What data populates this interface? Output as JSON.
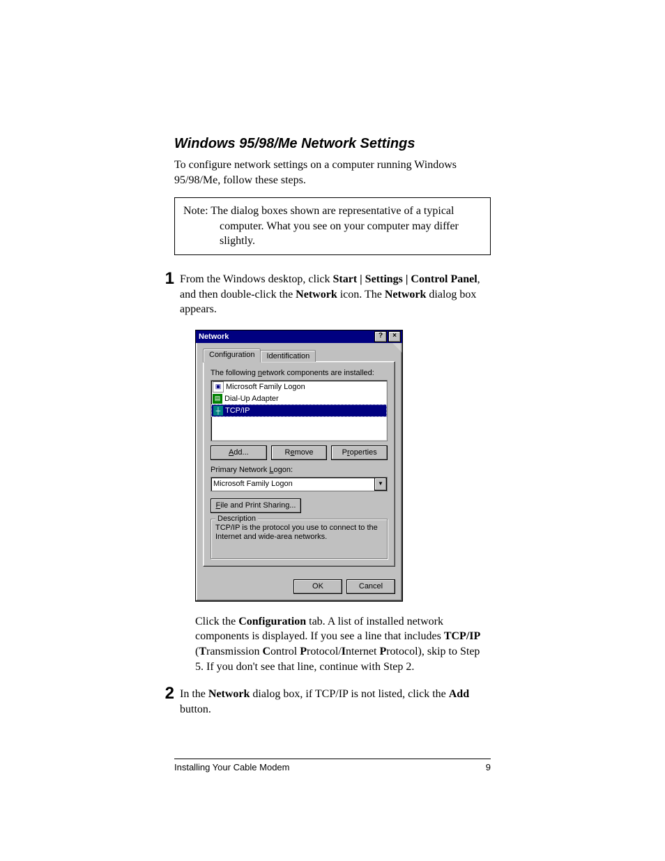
{
  "heading": "Windows 95/98/Me Network Settings",
  "intro": "To configure network settings on a computer running Windows 95/98/Me, follow these steps.",
  "note": {
    "label": "Note:",
    "line1": "The dialog boxes shown are representative of a typical",
    "line2": "computer. What you see on your computer may differ",
    "line3": "slightly."
  },
  "step1": {
    "num": "1",
    "pre": "From the Windows desktop, click ",
    "b1": "Start | Settings | Control Panel",
    "mid": ", and then double-click the ",
    "b2": "Network",
    "post1": " icon. The ",
    "b3": "Network",
    "post2": " dialog box appears."
  },
  "dialog": {
    "title": "Network",
    "help_btn": "?",
    "close_btn": "×",
    "tabs": {
      "configuration": "Configuration",
      "identification": "Identification"
    },
    "installed_label_pre": "The following ",
    "installed_label_u": "n",
    "installed_label_post": "etwork components are installed:",
    "items": {
      "0": "Microsoft Family Logon",
      "1": "Dial-Up Adapter",
      "2": "TCP/IP"
    },
    "buttons": {
      "add_u": "A",
      "add_post": "dd...",
      "remove_pre": "R",
      "remove_u": "e",
      "remove_post": "move",
      "properties_pre": "P",
      "properties_u": "r",
      "properties_post": "operties"
    },
    "primary_label_pre": "Primary Network ",
    "primary_label_u": "L",
    "primary_label_post": "ogon:",
    "primary_value": "Microsoft Family Logon",
    "fps_u": "F",
    "fps_post": "ile and Print Sharing...",
    "desc_legend": "Description",
    "desc_text": "TCP/IP is the protocol you use to connect to the Internet and wide-area networks.",
    "ok": "OK",
    "cancel": "Cancel"
  },
  "after1": {
    "pre": "Click the ",
    "b1": "Configuration",
    "mid1": " tab. A list of installed network components is displayed. If you see a line that includes ",
    "b2": "TCP/IP",
    "mid2": " (",
    "b3": "T",
    "mid3": "ransmission ",
    "b4": "C",
    "mid4": "ontrol ",
    "b5": "P",
    "mid5": "rotocol/",
    "b6": "I",
    "mid6": "nternet ",
    "b7": "P",
    "mid7": "rotocol), skip to Step 5. If you don't see that line, continue with Step 2."
  },
  "step2": {
    "num": "2",
    "pre": "In the ",
    "b1": "Network",
    "mid": " dialog box, if TCP/IP is not listed, click the ",
    "b2": "Add",
    "post": " button."
  },
  "footer": {
    "left": "Installing Your Cable Modem",
    "right": "9"
  }
}
